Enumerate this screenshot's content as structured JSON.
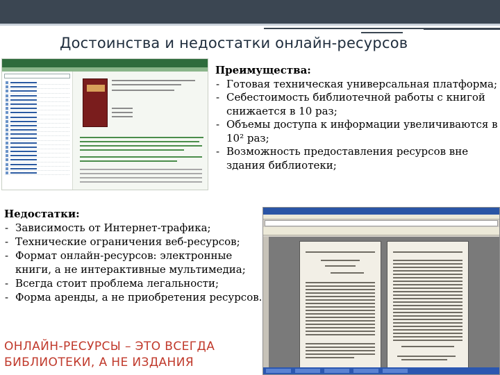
{
  "slide": {
    "title": "Достоинства и недостатки онлайн-ресурсов",
    "advantages": {
      "heading": "Преимущества:",
      "items": [
        "Готовая техническая  универсальная платформа;",
        "Себестоимость библиотечной работы с книгой снижается в 10 раз;",
        "Объемы доступа к информации увеличиваются в 10² раз;",
        "Возможность предоставления ресурсов вне здания библиотеки;"
      ]
    },
    "disadvantages": {
      "heading": "Недостатки:",
      "items": [
        "Зависимость от Интернет-трафика;",
        "Технические ограничения веб-ресурсов;",
        "Формат онлайн-ресурсов: электронные книги, а не интерактивные мультимедиа;",
        "Всегда стоит проблема легальности;",
        "Форма аренды, а не приобретения ресурсов."
      ]
    },
    "slogan": {
      "line1": "ОНЛАЙН-РЕСУРСЫ – ЭТО ВСЕГДА",
      "line2": "БИБЛИОТЕКИ, А НЕ ИЗДАНИЯ"
    },
    "colors": {
      "header_bar": "#3b4652",
      "title_text": "#1f2d3d",
      "slogan_text": "#c0392b"
    }
  }
}
